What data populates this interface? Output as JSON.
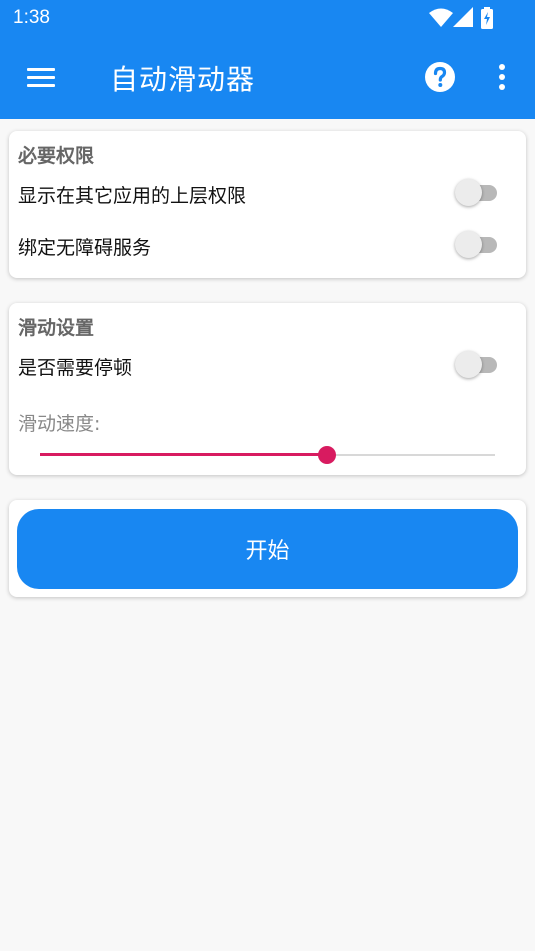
{
  "status_bar": {
    "time": "1:38",
    "icons": [
      "wifi-icon",
      "cell-signal-icon",
      "battery-charging-icon"
    ]
  },
  "app_bar": {
    "title": "自动滑动器",
    "menu_icon": "hamburger-menu-icon",
    "help_icon": "help-circle-icon",
    "more_icon": "more-vert-icon",
    "color": "#1887f2"
  },
  "permissions": {
    "title": "必要权限",
    "items": [
      {
        "label": "显示在其它应用的上层权限",
        "enabled": false
      },
      {
        "label": "绑定无障碍服务",
        "enabled": false
      }
    ]
  },
  "scroll_settings": {
    "title": "滑动设置",
    "pause_label": "是否需要停顿",
    "pause_enabled": false,
    "speed_label": "滑动速度:",
    "speed_fraction": 0.63,
    "slider_color": "#d81b60"
  },
  "start_button": {
    "label": "开始"
  }
}
